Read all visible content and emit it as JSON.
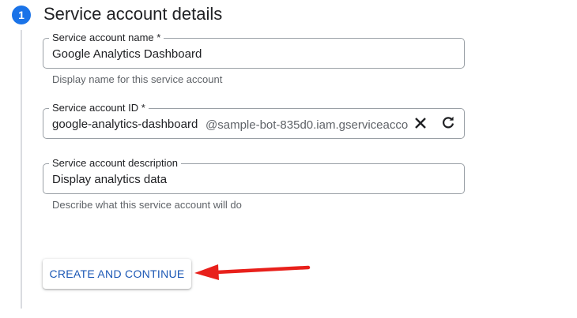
{
  "step": {
    "number": "1",
    "title": "Service account details",
    "accent_color": "#1a73e8"
  },
  "fields": {
    "name": {
      "label": "Service account name *",
      "value": "Google Analytics Dashboard",
      "hint": "Display name for this service account"
    },
    "id": {
      "label": "Service account ID *",
      "value": "google-analytics-dashboard",
      "suffix": "@sample-bot-835d0.iam.gserviceacco",
      "icons": [
        "close-icon",
        "refresh-icon"
      ]
    },
    "description": {
      "label": "Service account description",
      "value": "Display analytics data",
      "hint": "Describe what this service account will do"
    }
  },
  "actions": {
    "create_continue_label": "CREATE AND CONTINUE"
  },
  "annotation": {
    "arrow_color": "#e8201b",
    "icon": "left-arrow-icon"
  }
}
